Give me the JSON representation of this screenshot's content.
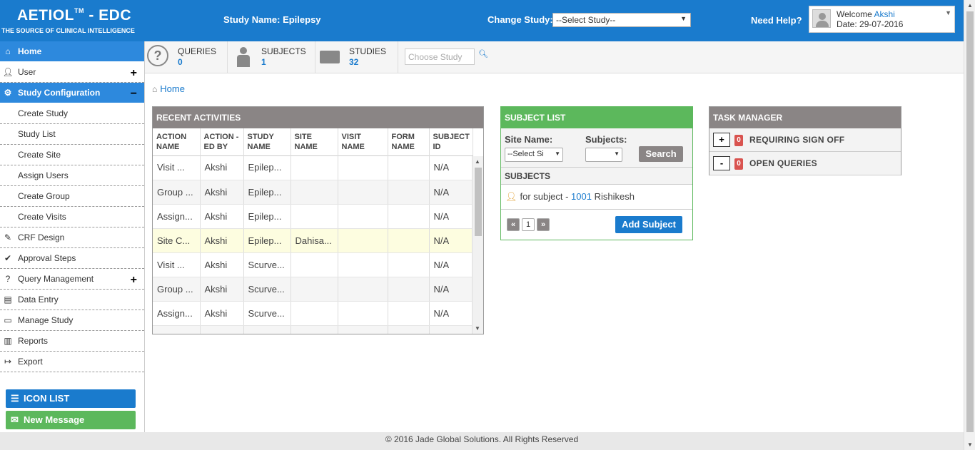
{
  "header": {
    "logo_main": "AETIOL",
    "logo_tm": "TM",
    "logo_suffix": " - EDC",
    "logo_sub": "THE SOURCE OF CLINICAL INTELLIGENCE",
    "study_name": "Study Name: Epilepsy",
    "change_study_label": "Change Study:",
    "change_study_value": "--Select Study--",
    "need_help": "Need Help?",
    "welcome_label": "Welcome",
    "welcome_name": "Akshi",
    "date_text": "Date: 29-07-2016"
  },
  "sidebar": {
    "items": [
      {
        "label": "Home",
        "icon": "home-icon"
      },
      {
        "label": "User",
        "icon": "user-icon",
        "toggle": "+"
      },
      {
        "label": "Study Configuration",
        "icon": "study-config-icon",
        "toggle": "−"
      },
      {
        "label": "Create Study"
      },
      {
        "label": "Study List"
      },
      {
        "label": "Create Site"
      },
      {
        "label": "Assign Users"
      },
      {
        "label": "Create Group"
      },
      {
        "label": "Create Visits"
      },
      {
        "label": "CRF Design",
        "icon": "crf-design-icon"
      },
      {
        "label": "Approval Steps",
        "icon": "approval-icon"
      },
      {
        "label": "Query Management",
        "icon": "query-icon",
        "toggle": "+"
      },
      {
        "label": "Data Entry",
        "icon": "data-entry-icon"
      },
      {
        "label": "Manage Study",
        "icon": "manage-study-icon"
      },
      {
        "label": "Reports",
        "icon": "reports-icon"
      },
      {
        "label": "Export",
        "icon": "export-icon"
      }
    ],
    "icon_list_label": "ICON LIST",
    "new_message_label": "New Message"
  },
  "stats": {
    "queries_label": "QUERIES",
    "queries_value": "0",
    "subjects_label": "SUBJECTS",
    "subjects_value": "1",
    "studies_label": "STUDIES",
    "studies_value": "32",
    "choose_study_placeholder": "Choose Study"
  },
  "breadcrumb": {
    "home": "Home"
  },
  "recent": {
    "title": "RECENT ACTIVITIES",
    "headers": [
      "ACTION NAME",
      "ACTION -ED BY",
      "STUDY NAME",
      "SITE NAME",
      "VISIT NAME",
      "FORM NAME",
      "SUBJECT ID"
    ],
    "rows": [
      [
        "Visit ...",
        "Akshi",
        "Epilep...",
        "",
        "",
        "",
        "N/A"
      ],
      [
        "Group ...",
        "Akshi",
        "Epilep...",
        "",
        "",
        "",
        "N/A"
      ],
      [
        "Assign...",
        "Akshi",
        "Epilep...",
        "",
        "",
        "",
        "N/A"
      ],
      [
        "Site C...",
        "Akshi",
        "Epilep...",
        "Dahisa...",
        "",
        "",
        "N/A"
      ],
      [
        "Visit ...",
        "Akshi",
        "Scurve...",
        "",
        "",
        "",
        "N/A"
      ],
      [
        "Group ...",
        "Akshi",
        "Scurve...",
        "",
        "",
        "",
        "N/A"
      ],
      [
        "Assign...",
        "Akshi",
        "Scurve...",
        "",
        "",
        "",
        "N/A"
      ],
      [
        "",
        "",
        "",
        "",
        "",
        "",
        ""
      ]
    ]
  },
  "subject_list": {
    "title": "SUBJECT LIST",
    "site_name_label": "Site Name:",
    "subjects_label": "Subjects:",
    "site_select_value": "--Select Si",
    "subjects_select_value": "",
    "search_label": "Search",
    "subheader": "SUBJECTS",
    "row_prefix": "for subject - ",
    "row_id": "1001",
    "row_name": " Rishikesh",
    "page_prev": "«",
    "page_current": "1",
    "page_next": "»",
    "add_subject_label": "Add Subject"
  },
  "task_manager": {
    "title": "TASK MANAGER",
    "rows": [
      {
        "toggle": "+",
        "count": "0",
        "label": "REQUIRING SIGN OFF"
      },
      {
        "toggle": "-",
        "count": "0",
        "label": "OPEN QUERIES"
      }
    ]
  },
  "footer": {
    "text": "© 2016 Jade Global Solutions. All Rights Reserved"
  },
  "colors": {
    "primary": "#1a7bcd",
    "green": "#5cb85c",
    "gray_header": "#8a8585",
    "badge_red": "#d9534f",
    "highlight_row": "#fdfde0"
  }
}
